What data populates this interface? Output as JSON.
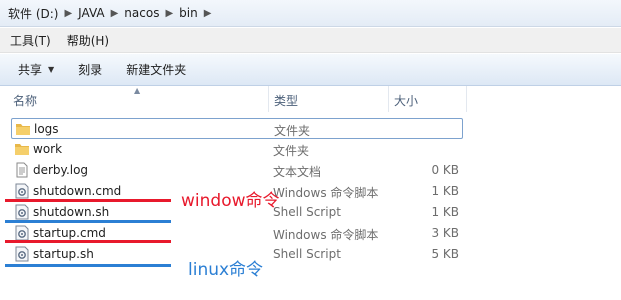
{
  "breadcrumb": [
    "软件 (D:)",
    "JAVA",
    "nacos",
    "bin"
  ],
  "menu": [
    "工具(T)",
    "帮助(H)"
  ],
  "toolbar": {
    "share_label": "共享",
    "burn_label": "刻录",
    "new_folder_label": "新建文件夹"
  },
  "columns": {
    "name": "名称",
    "type": "类型",
    "size": "大小"
  },
  "files": [
    {
      "name": "logs",
      "type": "文件夹",
      "size": "",
      "icon": "folder-icon"
    },
    {
      "name": "work",
      "type": "文件夹",
      "size": "",
      "icon": "folder-icon"
    },
    {
      "name": "derby.log",
      "type": "文本文档",
      "size": "0 KB",
      "icon": "text-file-icon"
    },
    {
      "name": "shutdown.cmd",
      "type": "Windows 命令脚本",
      "size": "1 KB",
      "icon": "script-file-icon"
    },
    {
      "name": "shutdown.sh",
      "type": "Shell Script",
      "size": "1 KB",
      "icon": "script-file-icon"
    },
    {
      "name": "startup.cmd",
      "type": "Windows 命令脚本",
      "size": "3 KB",
      "icon": "script-file-icon"
    },
    {
      "name": "startup.sh",
      "type": "Shell Script",
      "size": "5 KB",
      "icon": "script-file-icon"
    }
  ],
  "annotations": {
    "window_label": "window命令",
    "linux_label": "linux命令",
    "red": "#e8192c",
    "blue": "#2b7fd4"
  }
}
